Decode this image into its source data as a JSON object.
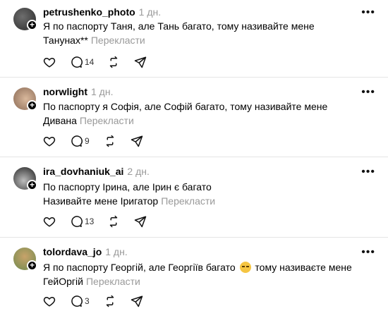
{
  "posts": [
    {
      "username": "petrushenko_photo",
      "time": "1 дн.",
      "lines": [
        "Я по паспорту Таня, але Тань багато, тому називайте мене",
        "Танунах**"
      ],
      "translate": "Перекласти",
      "reply_count": "14",
      "avatar_colors": [
        "#2a2a2a",
        "#6e6e6e"
      ]
    },
    {
      "username": "norwlight",
      "time": "1 дн.",
      "lines": [
        "По паспорту я Софія, але Софій багато, тому називайте мене",
        "Дивана"
      ],
      "translate": "Перекласти",
      "reply_count": "9",
      "avatar_colors": [
        "#d9b89c",
        "#8a6a55"
      ]
    },
    {
      "username": "ira_dovhaniuk_ai",
      "time": "2 дн.",
      "lines": [
        "По паспорту Ірина, але Ірин є багато",
        "Називайте мене Іригатор"
      ],
      "translate": "Перекласти",
      "reply_count": "13",
      "avatar_colors": [
        "#1c1c1c",
        "#bdbdbd"
      ]
    },
    {
      "username": "tolordava_jo",
      "time": "1 дн.",
      "lines": [
        "Я по паспорту Георгій, але Георгіїв багато",
        "тому називаєте мене",
        "ГейОргій"
      ],
      "translate": "Перекласти",
      "reply_count": "3",
      "avatar_colors": [
        "#6f8a4e",
        "#c8a36a"
      ]
    }
  ],
  "more_label": "•••",
  "plus_label": "+"
}
